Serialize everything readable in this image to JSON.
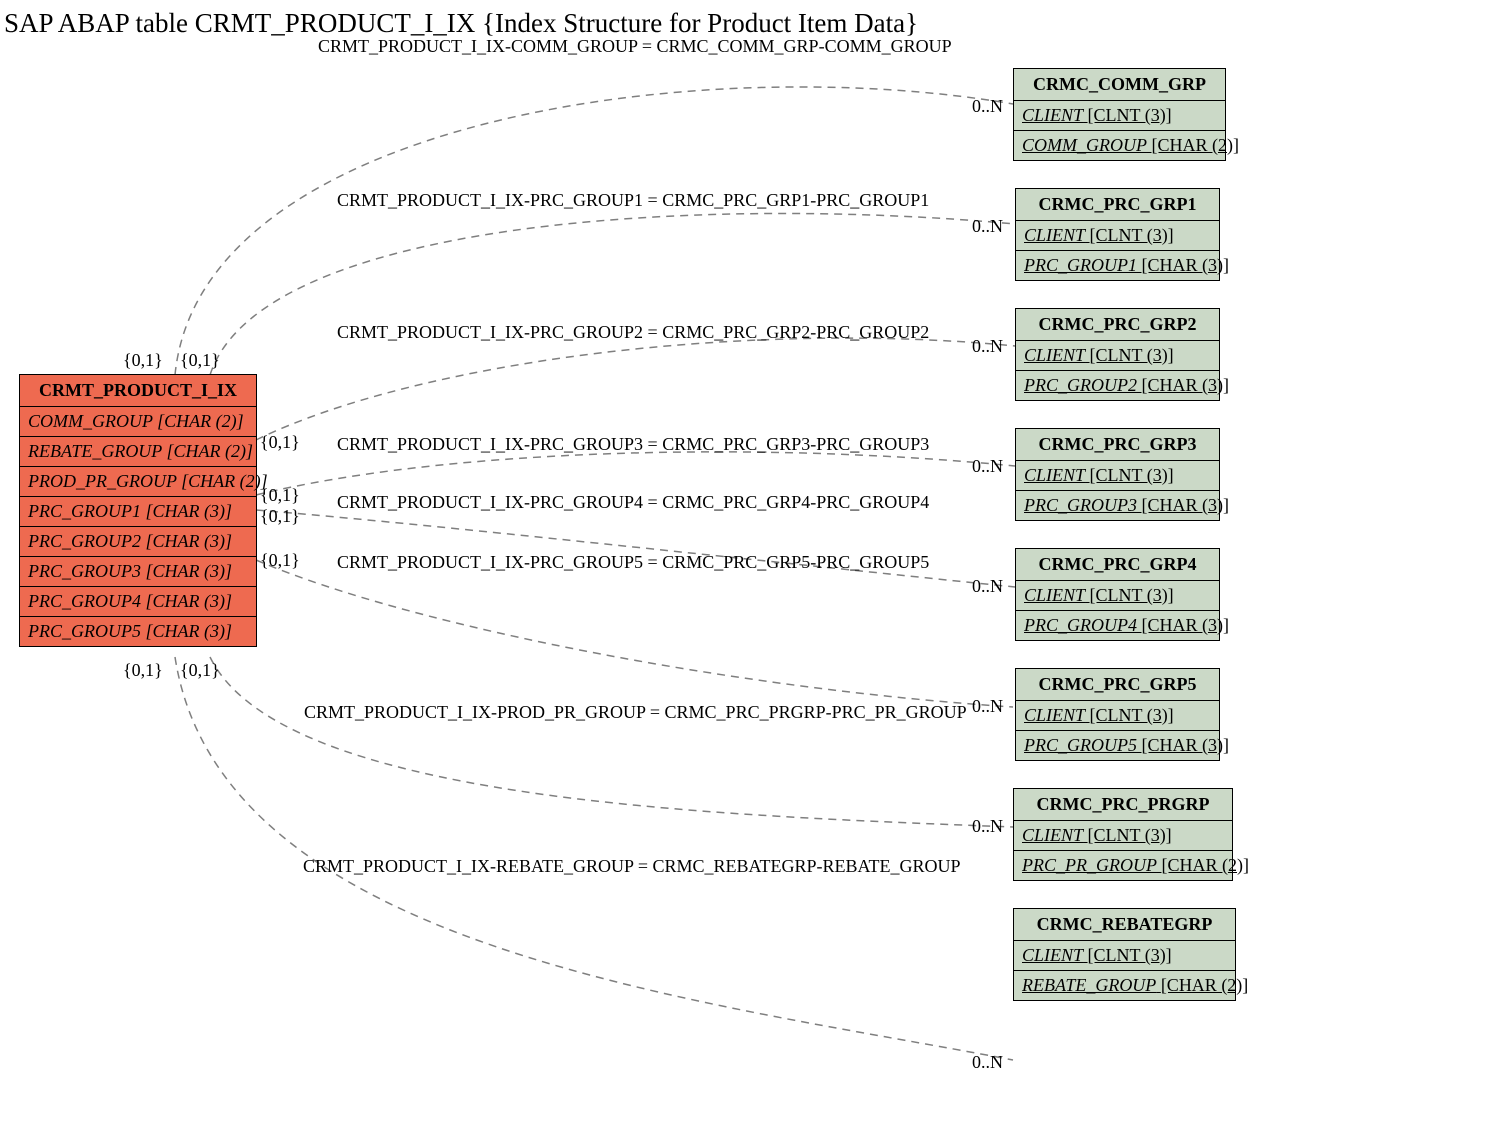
{
  "title": "SAP ABAP table CRMT_PRODUCT_I_IX {Index Structure for Product Item Data}",
  "main_entity": {
    "name": "CRMT_PRODUCT_I_IX",
    "fields": [
      {
        "name": "COMM_GROUP",
        "type": "[CHAR (2)]"
      },
      {
        "name": "REBATE_GROUP",
        "type": "[CHAR (2)]"
      },
      {
        "name": "PROD_PR_GROUP",
        "type": "[CHAR (2)]"
      },
      {
        "name": "PRC_GROUP1",
        "type": "[CHAR (3)]"
      },
      {
        "name": "PRC_GROUP2",
        "type": "[CHAR (3)]"
      },
      {
        "name": "PRC_GROUP3",
        "type": "[CHAR (3)]"
      },
      {
        "name": "PRC_GROUP4",
        "type": "[CHAR (3)]"
      },
      {
        "name": "PRC_GROUP5",
        "type": "[CHAR (3)]"
      }
    ]
  },
  "ref_entities": [
    {
      "name": "CRMC_COMM_GRP",
      "fields": [
        {
          "name": "CLIENT",
          "type": "[CLNT (3)]"
        },
        {
          "name": "COMM_GROUP",
          "type": "[CHAR (2)]"
        }
      ]
    },
    {
      "name": "CRMC_PRC_GRP1",
      "fields": [
        {
          "name": "CLIENT",
          "type": "[CLNT (3)]"
        },
        {
          "name": "PRC_GROUP1",
          "type": "[CHAR (3)]"
        }
      ]
    },
    {
      "name": "CRMC_PRC_GRP2",
      "fields": [
        {
          "name": "CLIENT",
          "type": "[CLNT (3)]"
        },
        {
          "name": "PRC_GROUP2",
          "type": "[CHAR (3)]"
        }
      ]
    },
    {
      "name": "CRMC_PRC_GRP3",
      "fields": [
        {
          "name": "CLIENT",
          "type": "[CLNT (3)]"
        },
        {
          "name": "PRC_GROUP3",
          "type": "[CHAR (3)]"
        }
      ]
    },
    {
      "name": "CRMC_PRC_GRP4",
      "fields": [
        {
          "name": "CLIENT",
          "type": "[CLNT (3)]"
        },
        {
          "name": "PRC_GROUP4",
          "type": "[CHAR (3)]"
        }
      ]
    },
    {
      "name": "CRMC_PRC_GRP5",
      "fields": [
        {
          "name": "CLIENT",
          "type": "[CLNT (3)]"
        },
        {
          "name": "PRC_GROUP5",
          "type": "[CHAR (3)]"
        }
      ]
    },
    {
      "name": "CRMC_PRC_PRGRP",
      "fields": [
        {
          "name": "CLIENT",
          "type": "[CLNT (3)]"
        },
        {
          "name": "PRC_PR_GROUP",
          "type": "[CHAR (2)]"
        }
      ]
    },
    {
      "name": "CRMC_REBATEGRP",
      "fields": [
        {
          "name": "CLIENT",
          "type": "[CLNT (3)]"
        },
        {
          "name": "REBATE_GROUP",
          "type": "[CHAR (2)]"
        }
      ]
    }
  ],
  "relations": [
    {
      "label": "CRMT_PRODUCT_I_IX-COMM_GROUP = CRMC_COMM_GRP-COMM_GROUP",
      "left_card": "{0,1}",
      "right_card": "0..N"
    },
    {
      "label": "CRMT_PRODUCT_I_IX-PRC_GROUP1 = CRMC_PRC_GRP1-PRC_GROUP1",
      "left_card": "{0,1}",
      "right_card": "0..N"
    },
    {
      "label": "CRMT_PRODUCT_I_IX-PRC_GROUP2 = CRMC_PRC_GRP2-PRC_GROUP2",
      "left_card": "{0,1}",
      "right_card": "0..N"
    },
    {
      "label": "CRMT_PRODUCT_I_IX-PRC_GROUP3 = CRMC_PRC_GRP3-PRC_GROUP3",
      "left_card": "{0,1}",
      "right_card": "0..N"
    },
    {
      "label": "CRMT_PRODUCT_I_IX-PRC_GROUP4 = CRMC_PRC_GRP4-PRC_GROUP4",
      "left_card": "{0,1}",
      "right_card": "0..N"
    },
    {
      "label": "CRMT_PRODUCT_I_IX-PRC_GROUP5 = CRMC_PRC_GRP5-PRC_GROUP5",
      "left_card": "{0,1}",
      "right_card": "0..N"
    },
    {
      "label": "CRMT_PRODUCT_I_IX-PROD_PR_GROUP = CRMC_PRC_PRGRP-PRC_PR_GROUP",
      "left_card": "{0,1}",
      "right_card": "0..N"
    },
    {
      "label": "CRMT_PRODUCT_I_IX-REBATE_GROUP = CRMC_REBATEGRP-REBATE_GROUP",
      "left_card": "{0,1}",
      "right_card": "0..N"
    }
  ]
}
